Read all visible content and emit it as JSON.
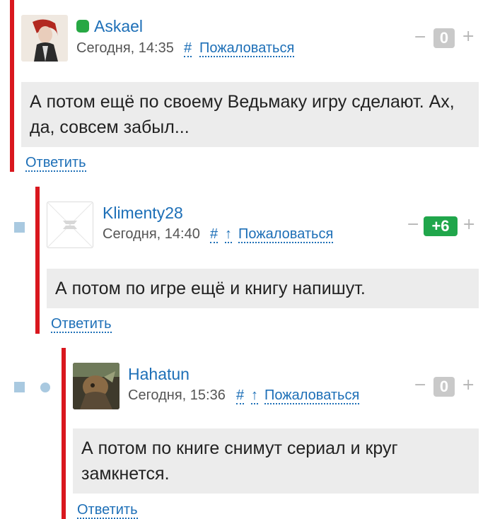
{
  "comments": [
    {
      "username": "Askael",
      "time": "Сегодня, 14:35",
      "hash": "#",
      "complain": "Пожаловаться",
      "text": "А потом ещё по своему Ведьмаку игру сделают. Ах, да, совсем забыл...",
      "reply": "Ответить",
      "score": "0",
      "minus": "−",
      "plus": "+",
      "online": true
    },
    {
      "username": "Klimenty28",
      "time": "Сегодня, 14:40",
      "hash": "#",
      "parent": "↑",
      "complain": "Пожаловаться",
      "text": "А потом по игре ещё и книгу напишут.",
      "reply": "Ответить",
      "score": "+6",
      "minus": "−",
      "plus": "+"
    },
    {
      "username": "Hahatun",
      "time": "Сегодня, 15:36",
      "hash": "#",
      "parent": "↑",
      "complain": "Пожаловаться",
      "text": "А потом по книге снимут сериал и круг замкнется.",
      "reply": "Ответить",
      "score": "0",
      "minus": "−",
      "plus": "+"
    }
  ],
  "colors": {
    "thread_bar": "#d9171e",
    "link": "#1d6fb7",
    "score_positive": "#20a64b",
    "score_neutral": "#c9c9c9",
    "online": "#27a844"
  }
}
